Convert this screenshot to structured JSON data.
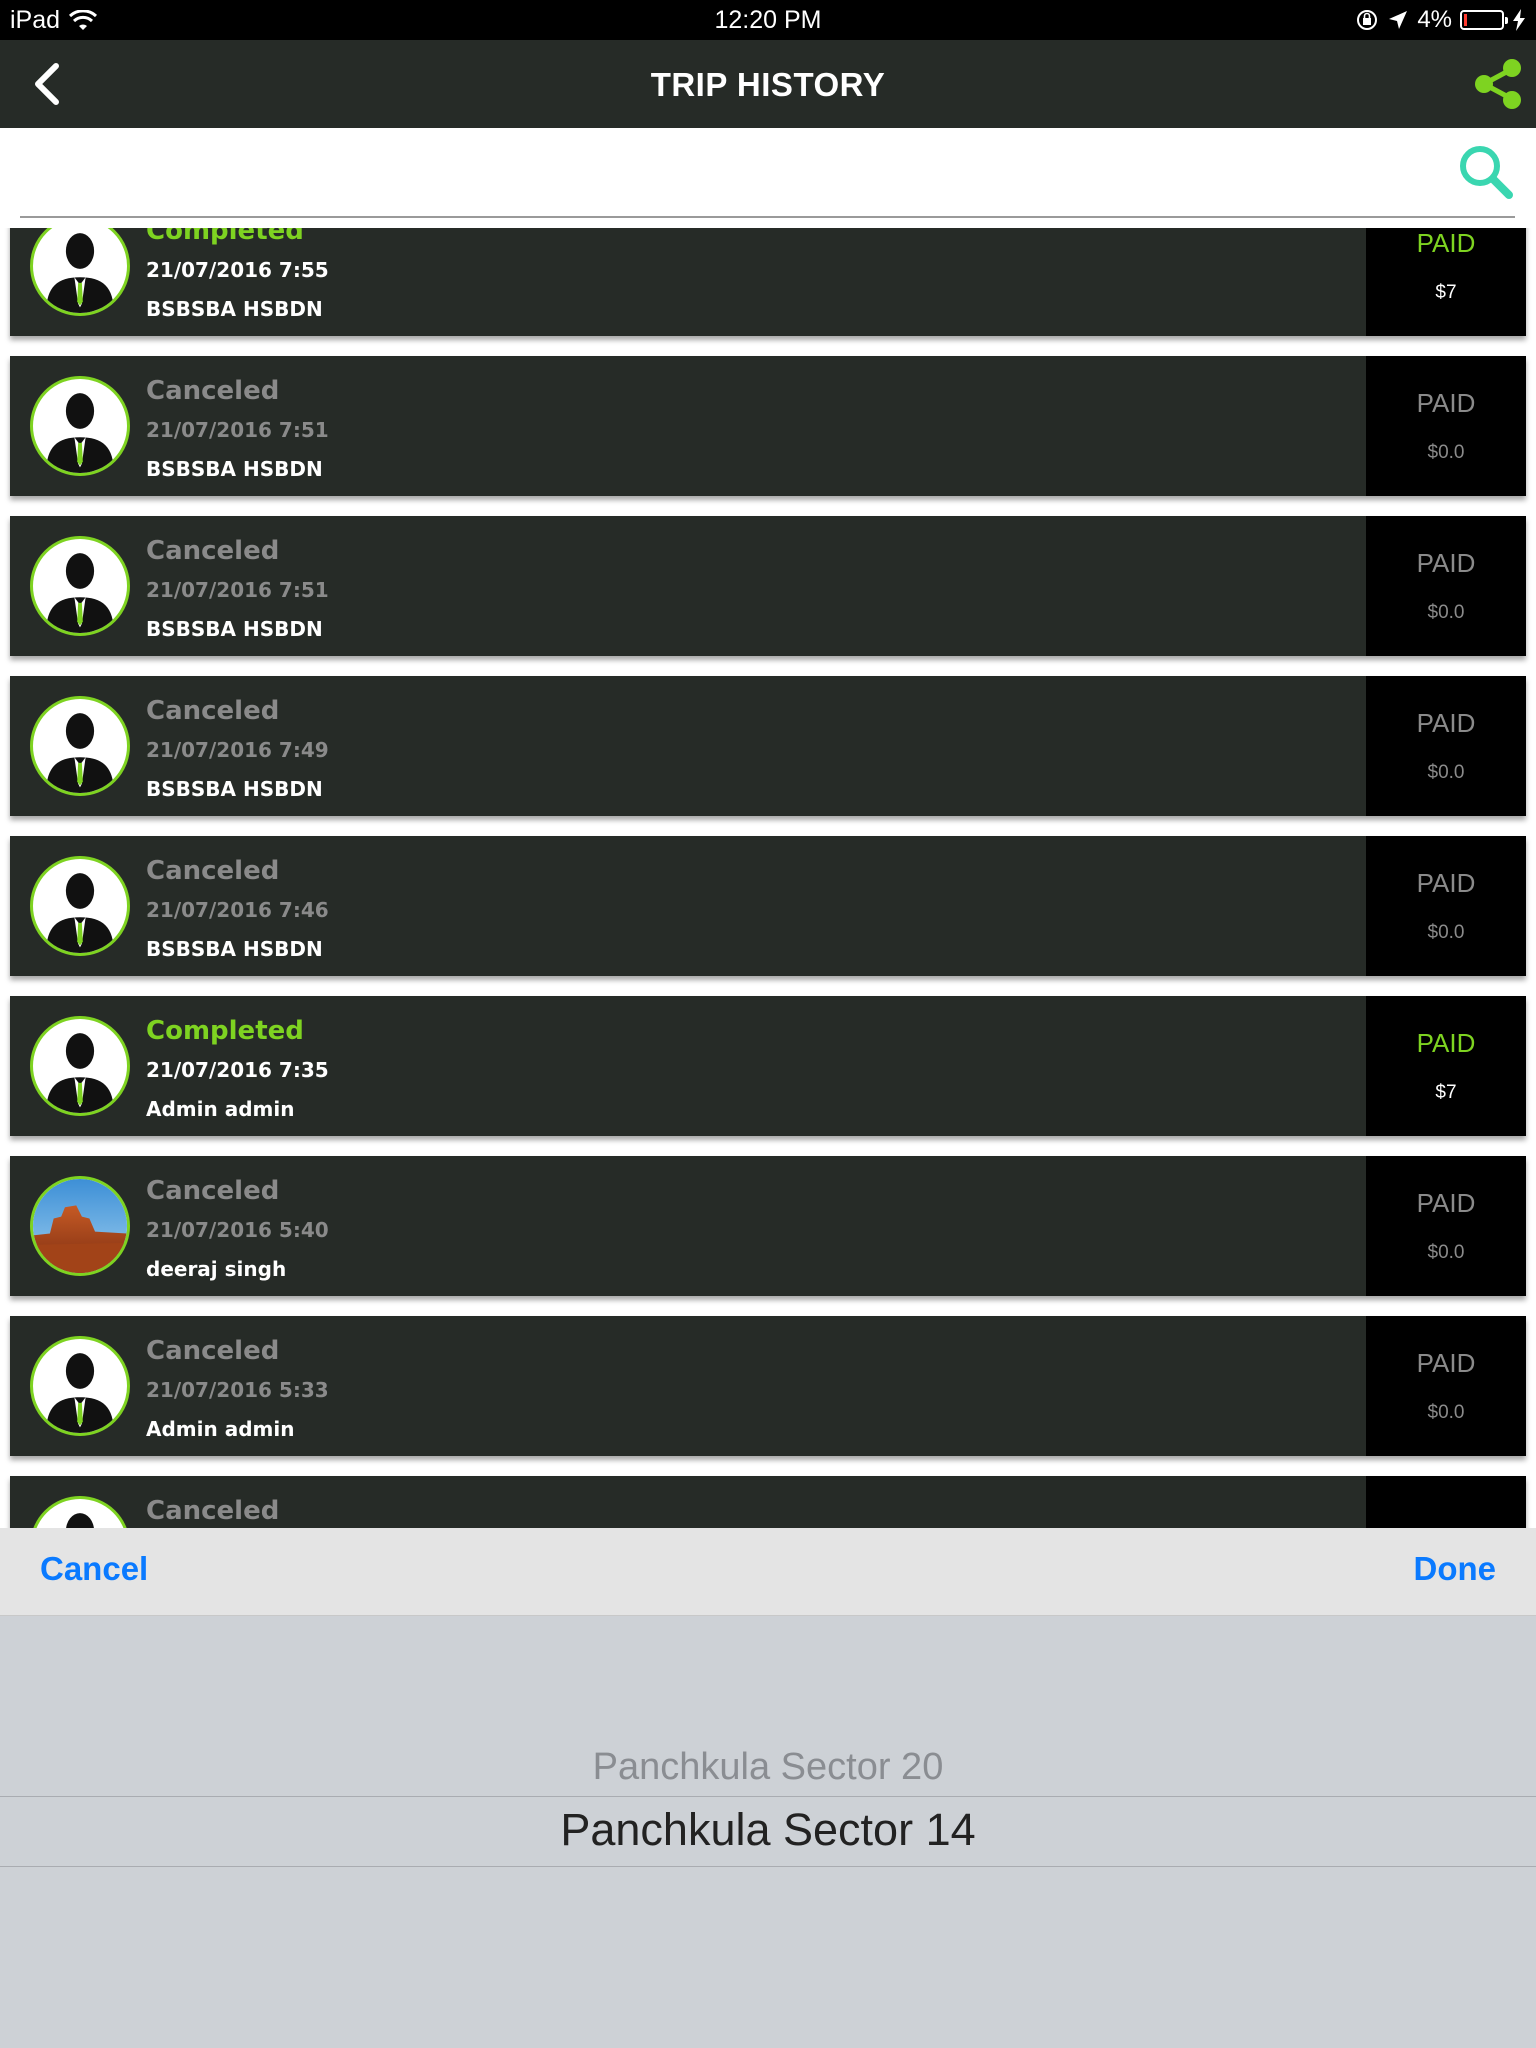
{
  "status_bar": {
    "device": "iPad",
    "time": "12:20 PM",
    "battery": "4%"
  },
  "nav": {
    "title": "TRIP HISTORY"
  },
  "search": {
    "placeholder": ""
  },
  "colors": {
    "accent_green": "#7ed321",
    "card_bg": "#262b27",
    "link_blue": "#0a7aff",
    "search_teal": "#3ad6b0"
  },
  "trips": [
    {
      "status": "Completed",
      "date": "21/07/2016 7:55",
      "name": "BSBSBA HSBDN",
      "paid": "PAID",
      "amount": "$7",
      "avatar": "person-silhouette"
    },
    {
      "status": "Canceled",
      "date": "21/07/2016 7:51",
      "name": "BSBSBA HSBDN",
      "paid": "PAID",
      "amount": "$0.0",
      "avatar": "person-silhouette"
    },
    {
      "status": "Canceled",
      "date": "21/07/2016 7:51",
      "name": "BSBSBA HSBDN",
      "paid": "PAID",
      "amount": "$0.0",
      "avatar": "person-silhouette"
    },
    {
      "status": "Canceled",
      "date": "21/07/2016 7:49",
      "name": "BSBSBA HSBDN",
      "paid": "PAID",
      "amount": "$0.0",
      "avatar": "person-silhouette"
    },
    {
      "status": "Canceled",
      "date": "21/07/2016 7:46",
      "name": "BSBSBA HSBDN",
      "paid": "PAID",
      "amount": "$0.0",
      "avatar": "person-silhouette"
    },
    {
      "status": "Completed",
      "date": "21/07/2016 7:35",
      "name": "Admin admin",
      "paid": "PAID",
      "amount": "$7",
      "avatar": "person-silhouette"
    },
    {
      "status": "Canceled",
      "date": "21/07/2016 5:40",
      "name": "deeraj singh",
      "paid": "PAID",
      "amount": "$0.0",
      "avatar": "landscape-photo"
    },
    {
      "status": "Canceled",
      "date": "21/07/2016 5:33",
      "name": "Admin admin",
      "paid": "PAID",
      "amount": "$0.0",
      "avatar": "person-silhouette"
    },
    {
      "status": "Canceled",
      "date": "",
      "name": "",
      "paid": "",
      "amount": "",
      "avatar": "person-silhouette"
    }
  ],
  "picker": {
    "cancel_label": "Cancel",
    "done_label": "Done",
    "options": [
      "Panchkula Sector 20",
      "Panchkula Sector 14"
    ],
    "selected": "Panchkula Sector 14"
  }
}
